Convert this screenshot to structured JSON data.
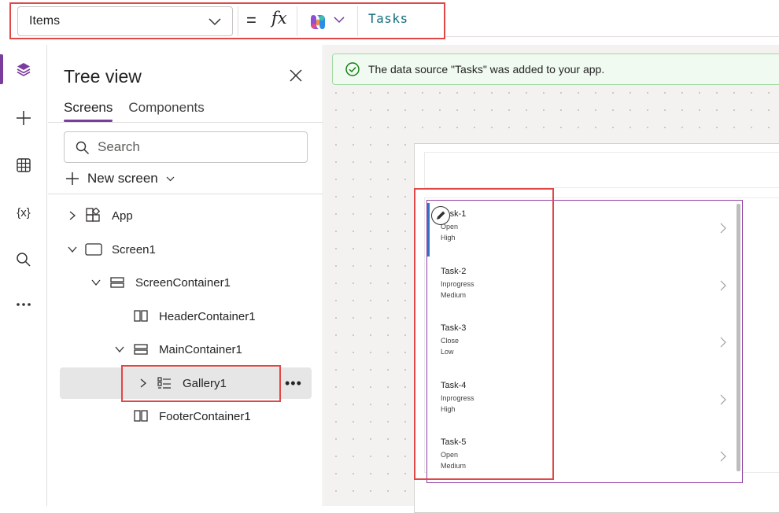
{
  "formula_bar": {
    "property": "Items",
    "equals": "=",
    "fx": "fx",
    "formula": "Tasks"
  },
  "rail": {
    "variables_label": "{x}"
  },
  "tree_view": {
    "title": "Tree view",
    "tabs": [
      "Screens",
      "Components"
    ],
    "search_placeholder": "Search",
    "new_screen": "New screen",
    "nodes": {
      "app": "App",
      "screen1": "Screen1",
      "screen_container": "ScreenContainer1",
      "header_container": "HeaderContainer1",
      "main_container": "MainContainer1",
      "gallery": "Gallery1",
      "footer_container": "FooterContainer1"
    }
  },
  "canvas": {
    "notification": "The data source \"Tasks\" was added to your app.",
    "gallery_items": [
      {
        "title": "Task-1",
        "status": "Open",
        "priority": "High"
      },
      {
        "title": "Task-2",
        "status": "Inprogress",
        "priority": "Medium"
      },
      {
        "title": "Task-3",
        "status": "Close",
        "priority": "Low"
      },
      {
        "title": "Task-4",
        "status": "Inprogress",
        "priority": "High"
      },
      {
        "title": "Task-5",
        "status": "Open",
        "priority": "Medium"
      }
    ]
  },
  "colors": {
    "accent": "#7a3d9d",
    "highlight": "#e04848",
    "formula_text": "#13707e",
    "success": "#107c10"
  }
}
